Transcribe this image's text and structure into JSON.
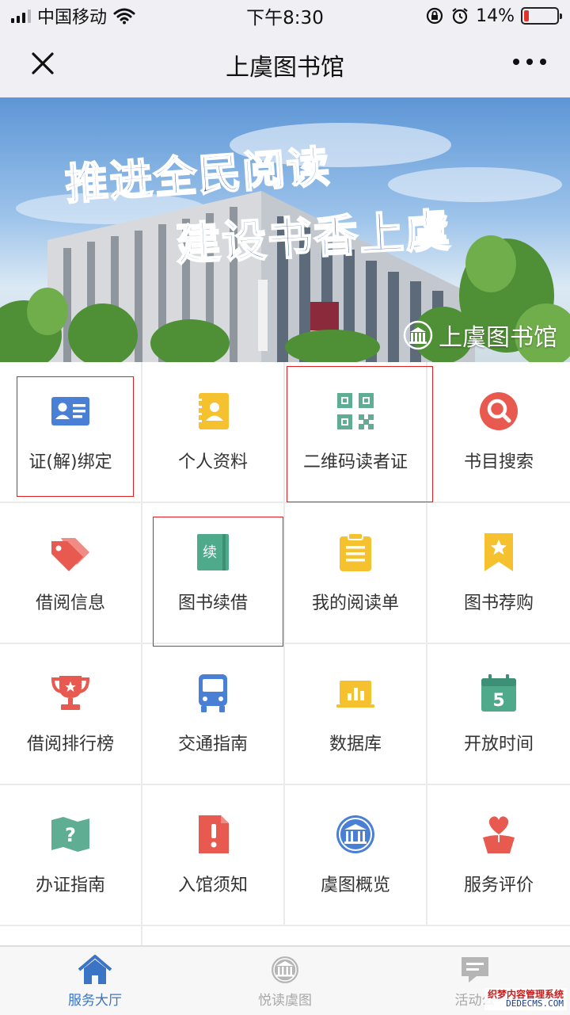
{
  "status_bar": {
    "carrier": "中国移动",
    "time": "下午8:30",
    "battery_text": "14%",
    "battery_level": 0.14
  },
  "nav": {
    "title": "上虞图书馆"
  },
  "banner": {
    "line1": "推进全民阅读",
    "line2": "建设书香上虞",
    "brand": "上虞图书馆"
  },
  "grid": {
    "items": [
      {
        "label": "证(解)绑定",
        "icon": "id-card-icon",
        "color": "#4a7fd6"
      },
      {
        "label": "个人资料",
        "icon": "address-book-icon",
        "color": "#f5c12e"
      },
      {
        "label": "二维码读者证",
        "icon": "qr-code-icon",
        "color": "#5fae94"
      },
      {
        "label": "书目搜索",
        "icon": "search-icon",
        "color": "#e8594f"
      },
      {
        "label": "借阅信息",
        "icon": "tags-icon",
        "color": "#e8594f"
      },
      {
        "label": "图书续借",
        "icon": "renew-book-icon",
        "color": "#4faa8c"
      },
      {
        "label": "我的阅读单",
        "icon": "clipboard-list-icon",
        "color": "#f5c12e"
      },
      {
        "label": "图书荐购",
        "icon": "bookmark-star-icon",
        "color": "#f5c12e"
      },
      {
        "label": "借阅排行榜",
        "icon": "trophy-icon",
        "color": "#e8594f"
      },
      {
        "label": "交通指南",
        "icon": "bus-icon",
        "color": "#4a7fd6"
      },
      {
        "label": "数据库",
        "icon": "database-chart-icon",
        "color": "#f5c12e"
      },
      {
        "label": "开放时间",
        "icon": "calendar-icon",
        "color": "#4faa8c"
      },
      {
        "label": "办证指南",
        "icon": "map-question-icon",
        "color": "#5fae94"
      },
      {
        "label": "入馆须知",
        "icon": "notice-icon",
        "color": "#e8594f"
      },
      {
        "label": "虞图概览",
        "icon": "library-building-icon",
        "color": "#4a7fd6"
      },
      {
        "label": "服务评价",
        "icon": "heart-flower-icon",
        "color": "#e8594f"
      }
    ],
    "calendar_number": "5",
    "renew_char": "续"
  },
  "tabs": [
    {
      "label": "服务大厅",
      "icon": "home-icon",
      "active": true
    },
    {
      "label": "悦读虞图",
      "icon": "library-icon",
      "active": false
    },
    {
      "label": "活动公",
      "icon": "chat-icon",
      "active": false
    }
  ],
  "watermark": {
    "line1": "织梦内容管理系统",
    "line2": "DEDECMS.COM"
  },
  "colors": {
    "accent": "#3b74c4",
    "highlight": "#e02020"
  }
}
